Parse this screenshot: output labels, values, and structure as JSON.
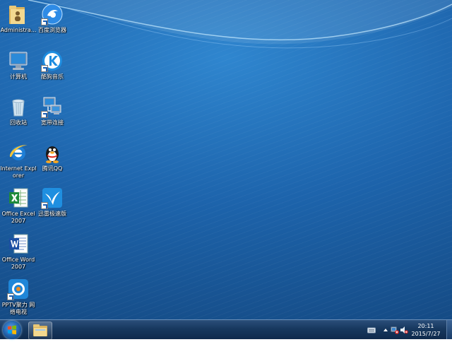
{
  "desktop": {
    "icons": [
      {
        "label": "Administra...",
        "icon": "user-folder-icon"
      },
      {
        "label": "百度浏览器",
        "icon": "baidu-browser-icon"
      },
      {
        "label": "计算机",
        "icon": "computer-icon"
      },
      {
        "label": "酷狗音乐",
        "icon": "kugou-music-icon"
      },
      {
        "label": "回收站",
        "icon": "recycle-bin-icon"
      },
      {
        "label": "宽带连接",
        "icon": "broadband-connection-icon"
      },
      {
        "label": "Internet Explorer",
        "icon": "internet-explorer-icon"
      },
      {
        "label": "腾讯QQ",
        "icon": "qq-penguin-icon"
      },
      {
        "label": "Office Excel 2007",
        "icon": "excel-icon"
      },
      {
        "label": "迅雷极速版",
        "icon": "xunlei-bird-icon"
      },
      {
        "label": "Office Word 2007",
        "icon": "word-icon"
      },
      {
        "label": "PPTV聚力 网络电视",
        "icon": "pptv-icon"
      }
    ]
  },
  "taskbar": {
    "clock_time": "20:11",
    "clock_date": "2015/7/27"
  },
  "colors": {
    "desktop_blue": "#1d64ac",
    "taskbar": "#17385f"
  }
}
